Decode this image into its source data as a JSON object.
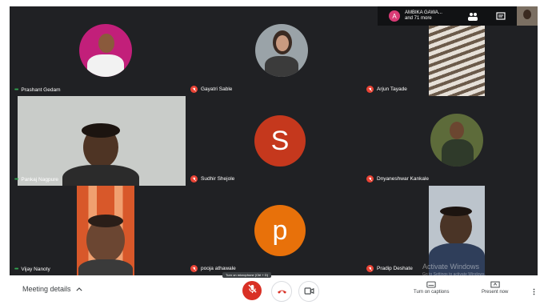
{
  "topbar": {
    "avatar_letter": "A",
    "name": "AMBIKA GAWA...",
    "more": "and 71 more"
  },
  "participants": [
    {
      "name": "Prashant Gedam"
    },
    {
      "name": "Gayatri Sable"
    },
    {
      "name": "Arjun Tayade"
    },
    {
      "name": "Pankaj Nagpure"
    },
    {
      "name": "Sudhir Shejole",
      "letter": "S"
    },
    {
      "name": "Dnyaneshwar Kankale"
    },
    {
      "name": "Vijay Nanoty"
    },
    {
      "name": "pooja athawale",
      "letter": "p"
    },
    {
      "name": "Pradip Deshate"
    }
  ],
  "bottom": {
    "meeting_details": "Meeting details",
    "tooltip": "Turn on microphone (Ctrl + D)",
    "captions": "Turn on captions",
    "present": "Present now"
  },
  "watermark": {
    "title": "Activate Windows",
    "sub": "Go to Settings to activate Windows."
  },
  "colors": {
    "tile_bg": "#202124",
    "s_avatar": "#c5381d",
    "p_avatar": "#e8710a",
    "mic_off": "#ea4335",
    "end_call": "#d93025"
  },
  "icons": [
    "mic-off-icon",
    "end-call-icon",
    "camera-icon",
    "captions-icon",
    "present-icon",
    "more-icon",
    "chevron-up-icon",
    "chat-icon"
  ]
}
